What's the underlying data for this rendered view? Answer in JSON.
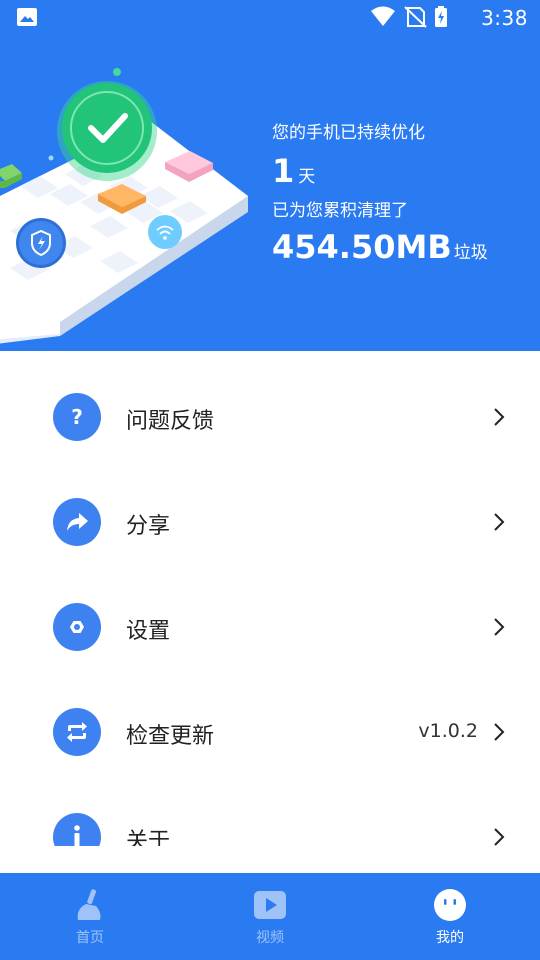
{
  "status_bar": {
    "time": "3:38"
  },
  "header": {
    "optimized_label": "您的手机已持续优化",
    "days_value": "1",
    "days_unit": "天",
    "cleaned_label": "已为您累积清理了",
    "cleaned_amount": "454.50MB",
    "cleaned_unit": "垃圾"
  },
  "menu": {
    "items": [
      {
        "label": "问题反馈",
        "icon": "question-icon",
        "value": ""
      },
      {
        "label": "分享",
        "icon": "share-icon",
        "value": ""
      },
      {
        "label": "设置",
        "icon": "settings-icon",
        "value": ""
      },
      {
        "label": "检查更新",
        "icon": "refresh-icon",
        "value": "v1.0.2"
      },
      {
        "label": "关于",
        "icon": "info-icon",
        "value": ""
      }
    ]
  },
  "tabbar": {
    "tabs": [
      {
        "label": "首页",
        "icon": "broom-icon",
        "active": false
      },
      {
        "label": "视频",
        "icon": "video-icon",
        "active": false
      },
      {
        "label": "我的",
        "icon": "face-icon",
        "active": true
      }
    ]
  },
  "colors": {
    "primary": "#2a7af2",
    "icon_bg": "#3e82f1",
    "success": "#22c47a"
  }
}
